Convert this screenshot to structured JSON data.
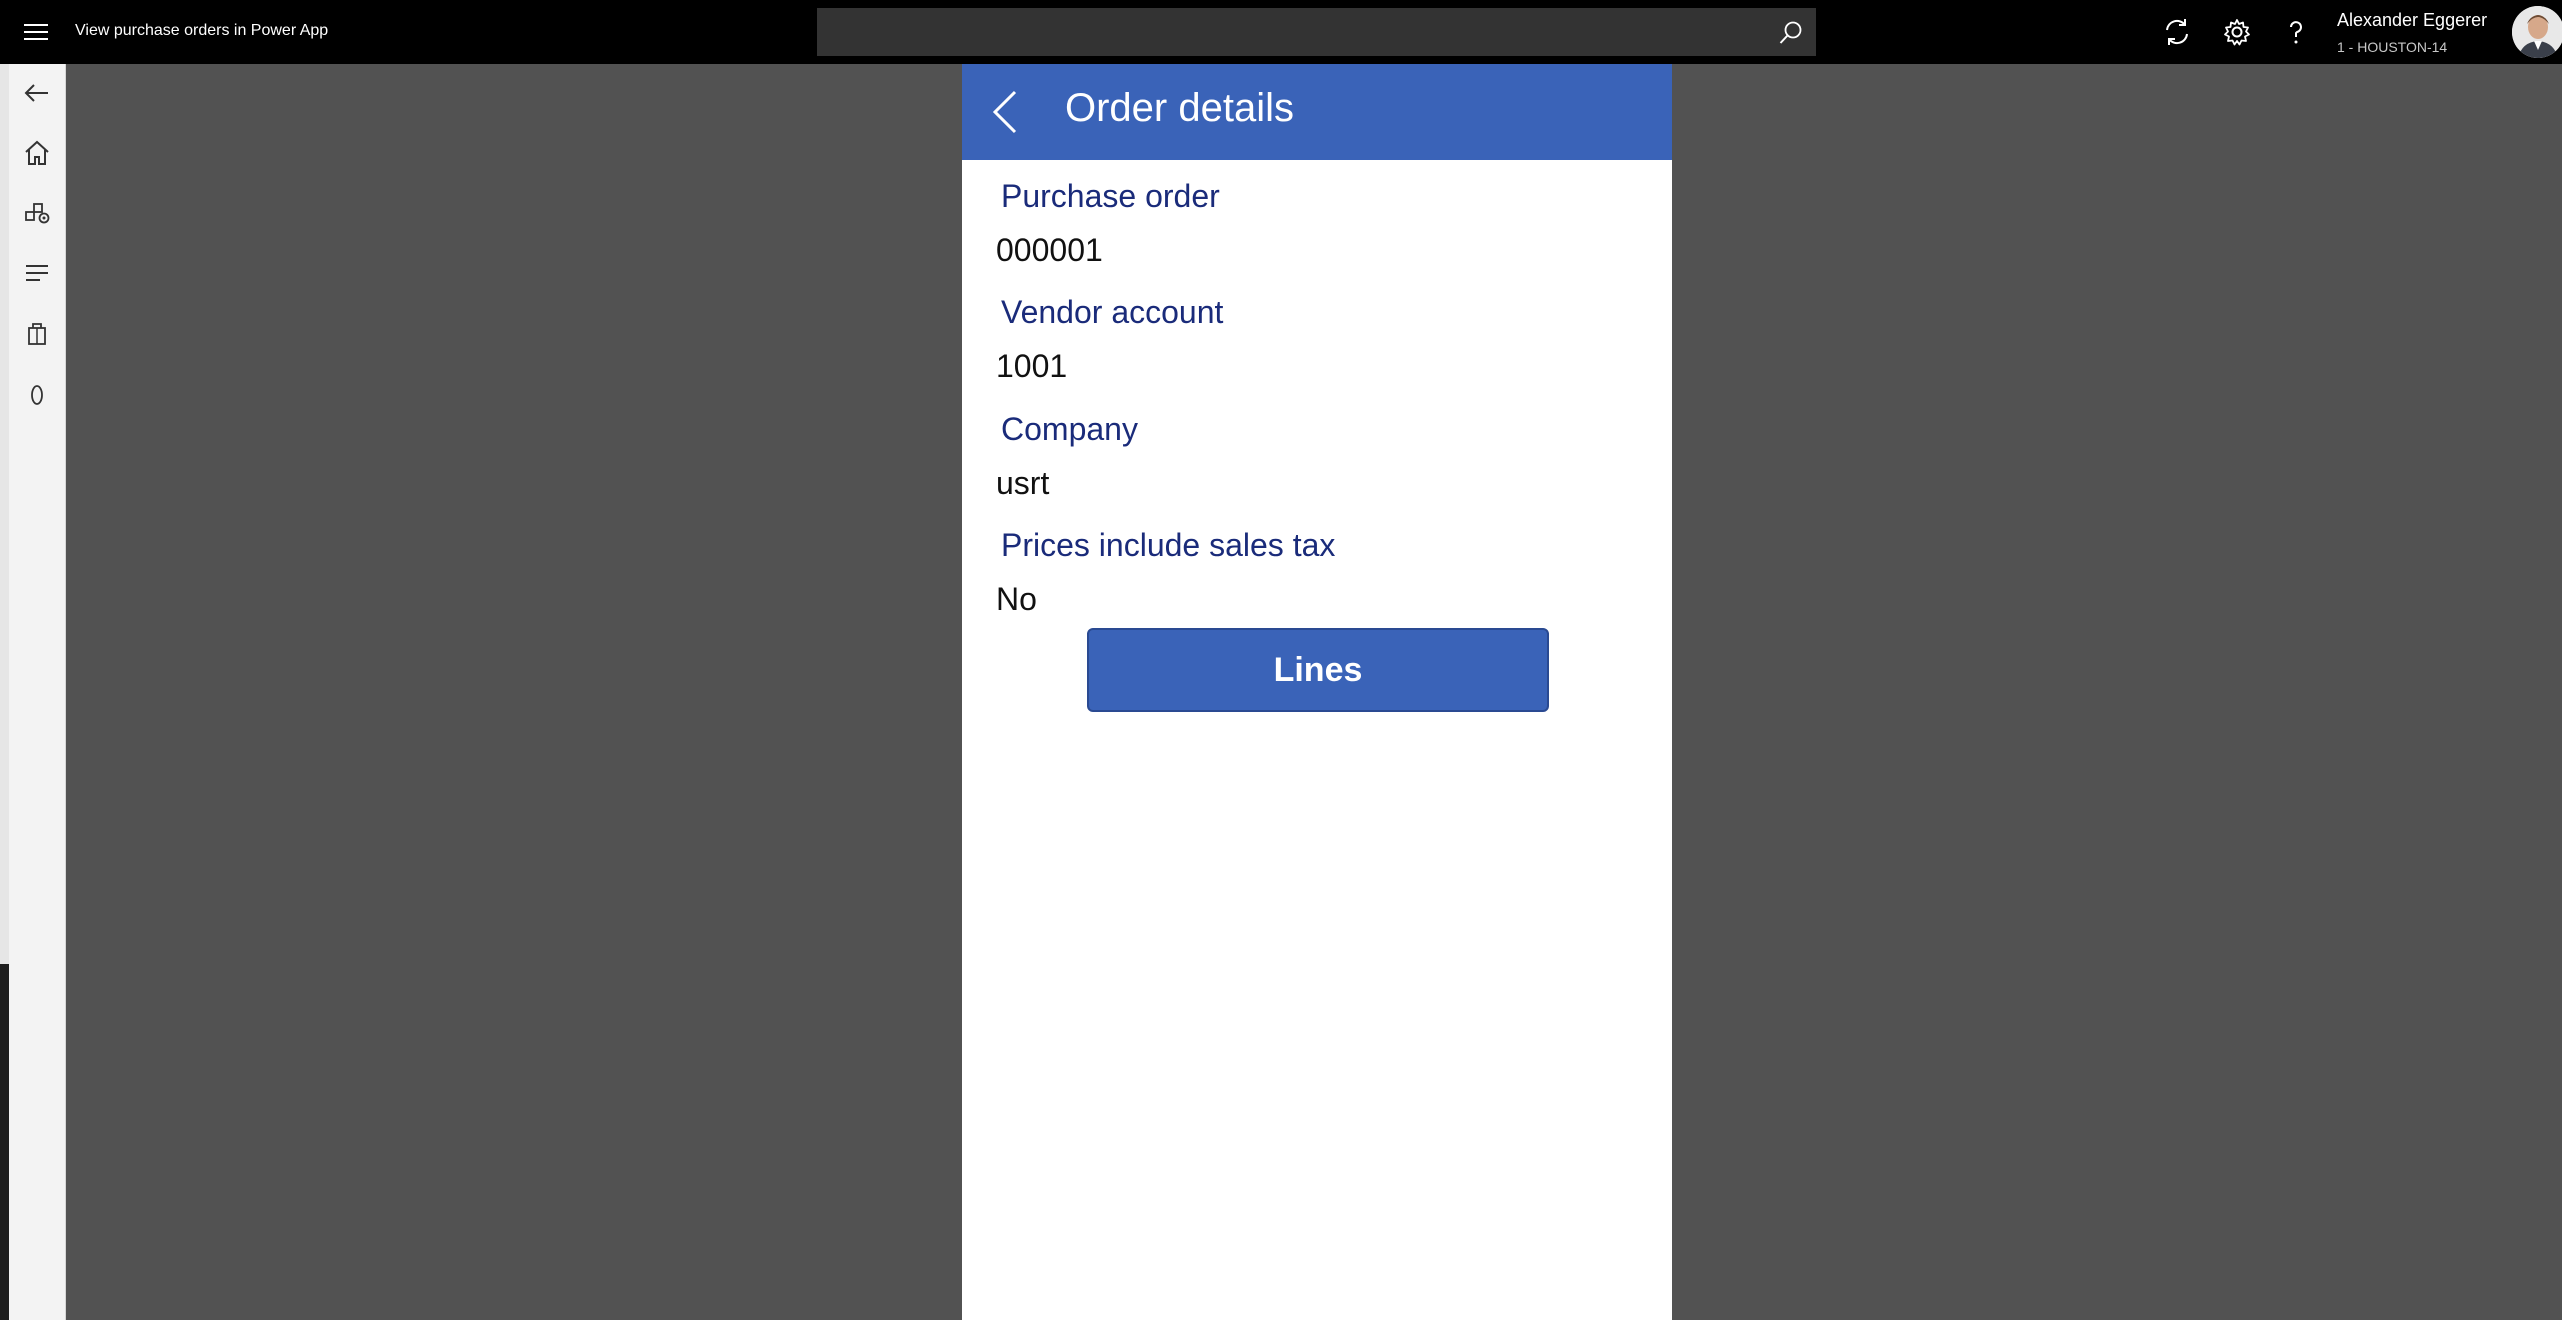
{
  "topbar": {
    "app_title": "View purchase orders in Power App",
    "search_placeholder": "",
    "user_name": "Alexander Eggerer",
    "user_company": "1 - HOUSTON-14"
  },
  "icons": {
    "menu": "hamburger-icon",
    "search": "search-icon",
    "refresh": "refresh-icon",
    "settings": "gear-icon",
    "help": "question-icon",
    "nav_back": "back-arrow-icon",
    "nav_home": "home-icon",
    "nav_modules": "modules-icon",
    "nav_list": "list-icon",
    "nav_bag": "bag-icon",
    "nav_zero": "zero-icon",
    "app_back": "chevron-left-icon"
  },
  "app": {
    "header_title": "Order details",
    "fields": [
      {
        "label": "Purchase order",
        "value": "000001"
      },
      {
        "label": "Vendor account",
        "value": "1001"
      },
      {
        "label": "Company",
        "value": "usrt"
      },
      {
        "label": "Prices include sales tax",
        "value": "No"
      }
    ],
    "lines_button": "Lines"
  },
  "colors": {
    "accent": "#3a63b8",
    "label": "#1a2b7a",
    "background": "#525252",
    "topbar": "#000000"
  }
}
